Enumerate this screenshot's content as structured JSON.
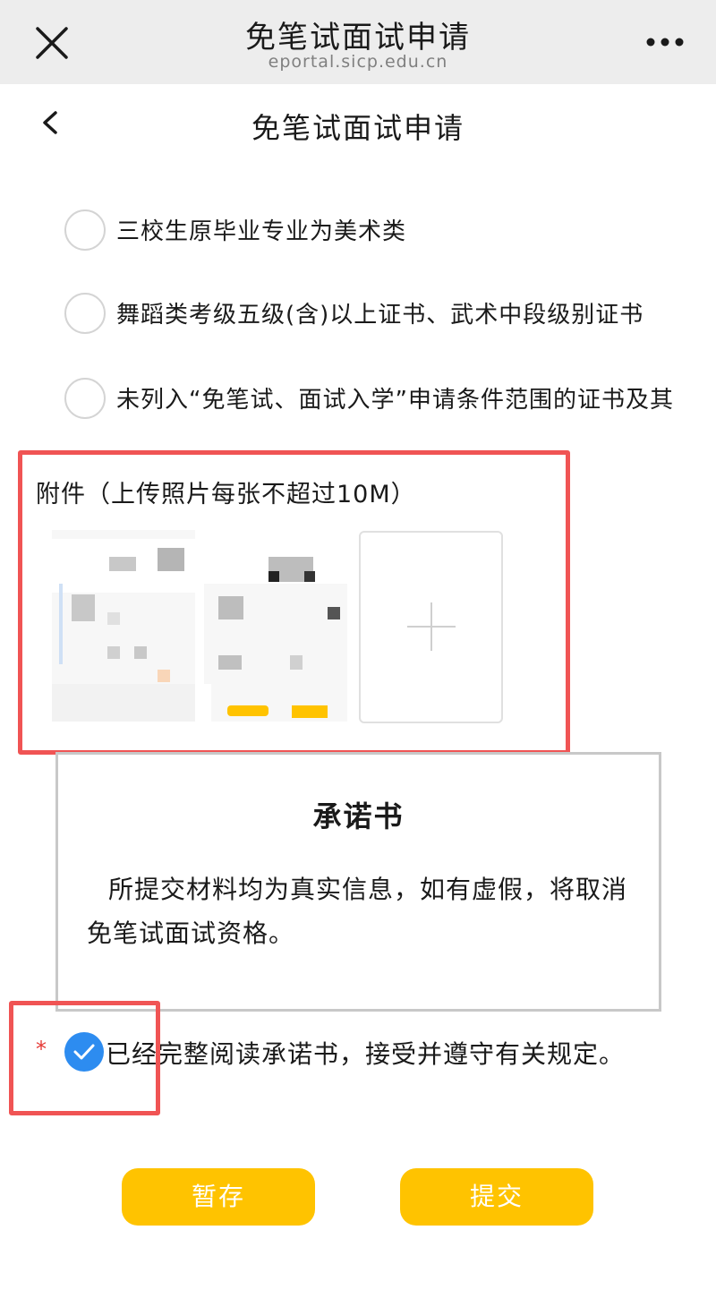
{
  "browser": {
    "title": "免笔试面试申请",
    "domain": "eportal.sicp.edu.cn"
  },
  "nav": {
    "title": "免笔试面试申请"
  },
  "options": [
    {
      "label": "三校生原毕业专业为美术类",
      "checked": false
    },
    {
      "label": "舞蹈类考级五级(含)以上证书、武术中段级别证书",
      "checked": false
    },
    {
      "label": "未列入“免笔试、面试入学”申请条件范围的证书及其",
      "checked": false
    }
  ],
  "attachments": {
    "label": "附件（上传照片每张不超过10M）",
    "add_icon": "plus-icon"
  },
  "pledge": {
    "title": "承诺书",
    "body": "所提交材料均为真实信息，如有虚假，将取消免笔试面试资格。"
  },
  "agreement": {
    "required_mark": "*",
    "text": "已经完整阅读承诺书，接受并遵守有关规定。",
    "checked": true
  },
  "buttons": {
    "save": "暂存",
    "submit": "提交"
  },
  "colors": {
    "accent": "#ffc300",
    "check": "#2d8cf0",
    "highlight": "#f05454"
  }
}
